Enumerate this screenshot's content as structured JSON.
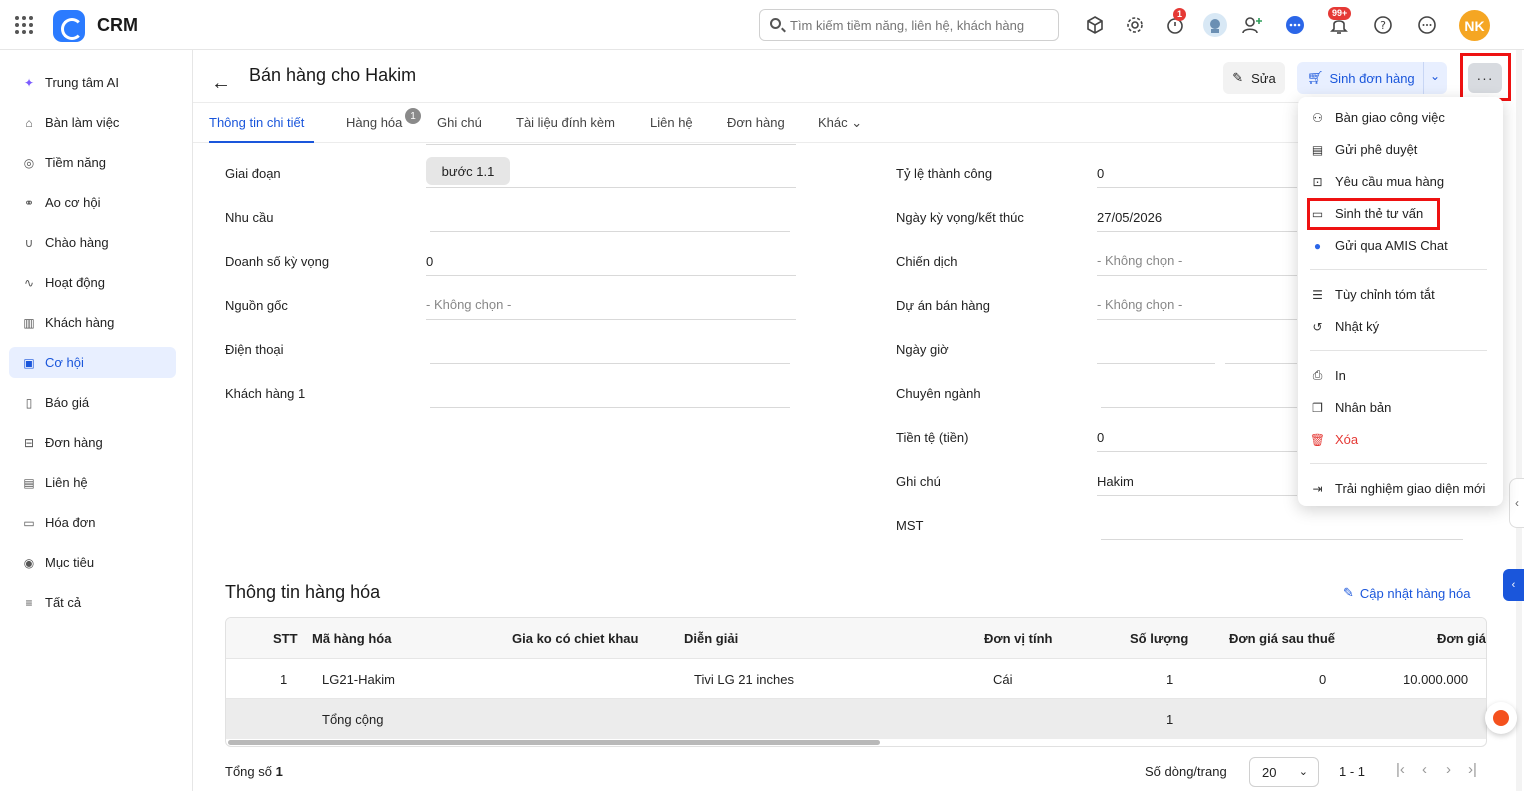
{
  "app": {
    "name": "CRM"
  },
  "search": {
    "placeholder": "Tìm kiếm tiềm năng, liên hệ, khách hàng"
  },
  "header_icons": [
    {
      "name": "cube-icon",
      "badge": ""
    },
    {
      "name": "gear-icon",
      "badge": ""
    },
    {
      "name": "timer-icon",
      "badge": "1"
    },
    {
      "name": "robot-avatar-icon",
      "badge": ""
    },
    {
      "name": "add-user-icon",
      "badge": ""
    },
    {
      "name": "chat-icon",
      "badge": ""
    },
    {
      "name": "bell-icon",
      "badge": "99+"
    },
    {
      "name": "help-icon",
      "badge": ""
    },
    {
      "name": "more-circle-icon",
      "badge": ""
    }
  ],
  "user": {
    "initials": "NK"
  },
  "sidebar": {
    "items": [
      {
        "label": "Trung tâm AI",
        "icon": "sparkle-icon"
      },
      {
        "label": "Bàn làm việc",
        "icon": "home-icon"
      },
      {
        "label": "Tiềm năng",
        "icon": "target-icon"
      },
      {
        "label": "Ao cơ hội",
        "icon": "pool-icon"
      },
      {
        "label": "Chào hàng",
        "icon": "magnet-icon"
      },
      {
        "label": "Hoạt động",
        "icon": "pulse-icon"
      },
      {
        "label": "Khách hàng",
        "icon": "building-icon"
      },
      {
        "label": "Cơ hội",
        "icon": "opportunity-icon",
        "active": true
      },
      {
        "label": "Báo giá",
        "icon": "quote-icon"
      },
      {
        "label": "Đơn hàng",
        "icon": "cart-icon"
      },
      {
        "label": "Liên hệ",
        "icon": "contact-icon"
      },
      {
        "label": "Hóa đơn",
        "icon": "invoice-icon"
      },
      {
        "label": "Mục tiêu",
        "icon": "goal-icon"
      },
      {
        "label": "Tất cả",
        "icon": "menu-icon"
      }
    ]
  },
  "page": {
    "title": "Bán hàng cho Hakim",
    "edit_label": "Sửa",
    "generate_order_label": "Sinh đơn hàng",
    "more_label": "···"
  },
  "tabs": [
    {
      "label": "Thông tin chi tiết",
      "active": true
    },
    {
      "label": "Hàng hóa",
      "badge": "1"
    },
    {
      "label": "Ghi chú"
    },
    {
      "label": "Tài liệu đính kèm"
    },
    {
      "label": "Liên hệ"
    },
    {
      "label": "Đơn hàng"
    },
    {
      "label": "Khác"
    }
  ],
  "details_left": [
    {
      "label": "Giai đoạn",
      "value": "bước 1.1"
    },
    {
      "label": "Nhu cầu",
      "value": ""
    },
    {
      "label": "Doanh số kỳ vọng",
      "value": "0"
    },
    {
      "label": "Nguồn gốc",
      "value": "- Không chọn -"
    },
    {
      "label": "Điện thoại",
      "value": ""
    },
    {
      "label": "Khách hàng 1",
      "value": ""
    }
  ],
  "details_right": [
    {
      "label": "Tỷ lệ thành công",
      "value": "0"
    },
    {
      "label": "Ngày kỳ vọng/kết thúc",
      "value": "27/05/2026"
    },
    {
      "label": "Chiến dịch",
      "value": "- Không chọn -"
    },
    {
      "label": "Dự án bán hàng",
      "value": "- Không chọn -"
    },
    {
      "label": "Ngày giờ",
      "value": ""
    },
    {
      "label": "Chuyên ngành",
      "value": ""
    },
    {
      "label": "Tiền tệ (tiền)",
      "value": "0"
    },
    {
      "label": "Ghi chú",
      "value": "Hakim"
    },
    {
      "label": "MST",
      "value": ""
    }
  ],
  "products": {
    "title": "Thông tin hàng hóa",
    "update_label": "Cập nhật hàng hóa",
    "columns": [
      "STT",
      "Mã hàng hóa",
      "Gia ko có chiet khau",
      "Diễn giải",
      "Đơn vị tính",
      "Số lượng",
      "Đơn giá sau thuế",
      "Đơn giá"
    ],
    "rows": [
      [
        "1",
        "LG21-Hakim",
        "",
        "Tivi LG 21 inches",
        "Cái",
        "1",
        "0",
        "10.000.000"
      ]
    ],
    "total_label": "Tổng cộng",
    "total_quantity": "1",
    "footer_total_prefix": "Tổng số",
    "footer_total_count": "1",
    "rows_per_page_label": "Số dòng/trang",
    "rows_per_page": "20",
    "range": "1 - 1"
  },
  "more_menu": [
    {
      "label": "Bàn giao công việc",
      "icon": "handover-icon"
    },
    {
      "label": "Gửi phê duyệt",
      "icon": "approval-icon"
    },
    {
      "label": "Yêu cầu mua hàng",
      "icon": "purchase-request-icon"
    },
    {
      "label": "Sinh thẻ tư vấn",
      "icon": "card-icon",
      "highlighted": true
    },
    {
      "label": "Gửi qua AMIS Chat",
      "icon": "amis-chat-icon"
    },
    {
      "label": "Tùy chỉnh tóm tắt",
      "icon": "sliders-icon"
    },
    {
      "label": "Nhật ký",
      "icon": "history-icon"
    },
    {
      "label": "In",
      "icon": "print-icon"
    },
    {
      "label": "Nhân bản",
      "icon": "duplicate-icon"
    },
    {
      "label": "Xóa",
      "icon": "trash-icon",
      "danger": true
    },
    {
      "label": "Trải nghiệm giao diện mới",
      "icon": "new-ui-icon"
    }
  ],
  "colors": {
    "accent": "#1a56db",
    "danger": "#e53935",
    "highlight_box": "#ee1111",
    "avatar": "#f5a623"
  }
}
